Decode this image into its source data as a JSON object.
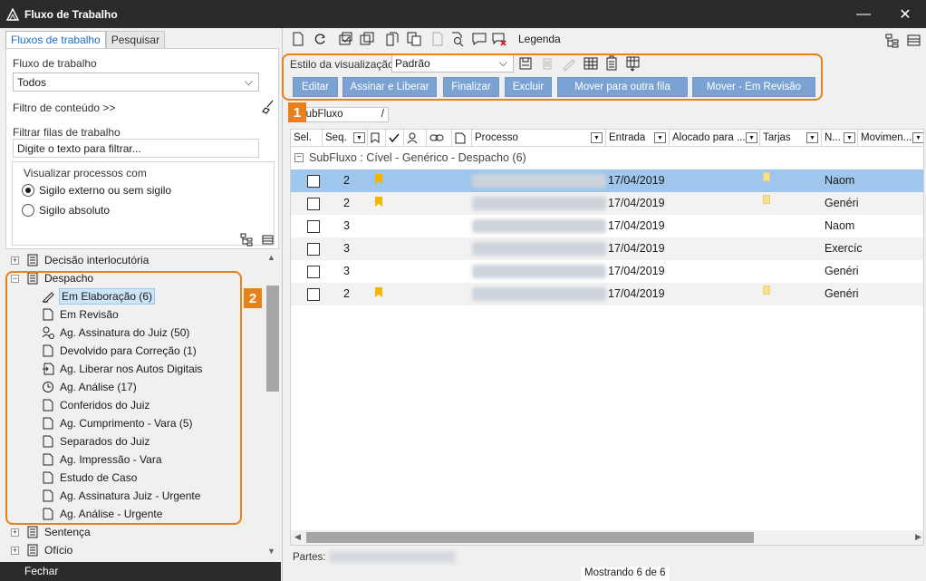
{
  "window": {
    "title": "Fluxo de Trabalho"
  },
  "left": {
    "tabs": [
      "Fluxos de trabalho",
      "Pesquisar"
    ],
    "workflow_label": "Fluxo de trabalho",
    "workflow_value": "Todos",
    "content_filter": "Filtro de conteúdo >>",
    "filter_label": "Filtrar filas de trabalho",
    "filter_placeholder": "Digite o texto para filtrar...",
    "visualize_label": "Visualizar processos com",
    "radio1": "Sigilo externo ou sem sigilo",
    "radio2": "Sigilo absoluto",
    "tree": {
      "decisao": "Decisão interlocutória",
      "despacho": "Despacho",
      "items": [
        "Em Elaboração (6)",
        "Em Revisão",
        "Ag. Assinatura do Juiz (50)",
        "Devolvido para Correção (1)",
        "Ag. Liberar nos Autos Digitais",
        "Ag. Análise (17)",
        "Conferidos do Juiz",
        "Ag. Cumprimento - Vara (5)",
        "Separados do Juiz",
        "Ag. Impressão - Vara",
        "Estudo de Caso",
        "Ag. Assinatura Juiz - Urgente",
        "Ag. Análise - Urgente"
      ],
      "sentenca": "Sentença",
      "oficio": "Ofício"
    },
    "close_label": "Fechar",
    "badge2": "2"
  },
  "right": {
    "legend_label": "Legenda",
    "view_style_label": "Estilo da visualização",
    "view_style_value": "Padrão",
    "badge1": "1",
    "actions": [
      "Editar",
      "Assinar e Liberar",
      "Finalizar",
      "Excluir",
      "Mover para outra fila",
      "Mover - Em Revisão"
    ],
    "subfluxo_chip": "SubFluxo",
    "subfluxo_chip_sep": "/",
    "columns": {
      "sel": "Sel.",
      "seq": "Seq.",
      "processo": "Processo",
      "entrada": "Entrada",
      "alocado": "Alocado para ...",
      "tarjas": "Tarjas",
      "n": "N...",
      "movimento": "Movimen..."
    },
    "group_title": "SubFluxo : Cível - Genérico - Despacho  (6)",
    "rows": [
      {
        "seq": "2",
        "entrada": "17/04/2019",
        "n": "Naom"
      },
      {
        "seq": "2",
        "entrada": "17/04/2019",
        "n": "Genéri"
      },
      {
        "seq": "3",
        "entrada": "17/04/2019",
        "n": "Naom"
      },
      {
        "seq": "3",
        "entrada": "17/04/2019",
        "n": "Exercíc"
      },
      {
        "seq": "3",
        "entrada": "17/04/2019",
        "n": "Genéri"
      },
      {
        "seq": "2",
        "entrada": "17/04/2019",
        "n": "Genéri"
      }
    ],
    "partes_label": "Partes:",
    "status": "Mostrando 6 de 6"
  }
}
